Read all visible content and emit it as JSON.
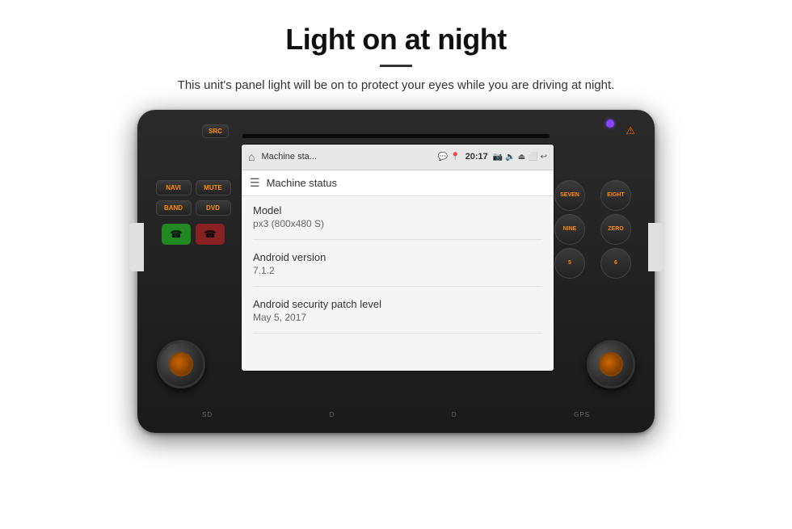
{
  "page": {
    "title": "Light on at night",
    "subtitle": "This unit's panel light will be on to protect your eyes while you are driving at night."
  },
  "device": {
    "status_bar": {
      "app_name": "Machine sta...",
      "time": "20:17"
    },
    "app_bar_title": "Machine status",
    "info_items": [
      {
        "label": "Model",
        "value": "px3 (800x480 S)"
      },
      {
        "label": "Android version",
        "value": "7.1.2"
      },
      {
        "label": "Android security patch level",
        "value": "May 5, 2017"
      }
    ],
    "left_buttons": [
      {
        "row": [
          "SRC"
        ]
      },
      {
        "row": [
          "NAVI",
          "MUTE"
        ]
      },
      {
        "row": [
          "BAND",
          "DVD"
        ]
      }
    ],
    "right_buttons": [
      {
        "label": "SEVEN",
        "sub": ""
      },
      {
        "label": "EIGHT",
        "sub": ""
      },
      {
        "label": "NINE",
        "sub": ""
      },
      {
        "label": "ZERO",
        "sub": ""
      },
      {
        "label": "5",
        "sub": ""
      },
      {
        "label": "6",
        "sub": ""
      }
    ],
    "bottom_labels": [
      "SD",
      "D",
      "D",
      "GPS"
    ]
  }
}
